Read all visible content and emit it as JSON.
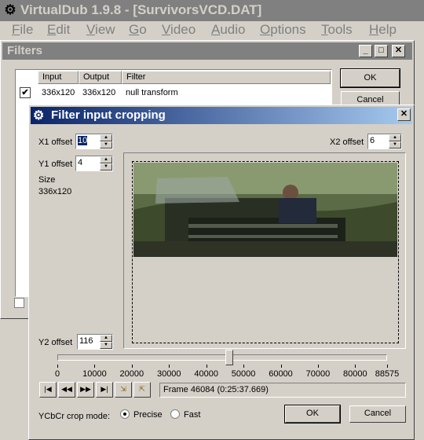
{
  "main": {
    "title": "VirtualDub 1.9.8 - [SurvivorsVCD.DAT]",
    "menu": [
      "File",
      "Edit",
      "View",
      "Go",
      "Video",
      "Audio",
      "Options",
      "Tools",
      "Help"
    ]
  },
  "filters": {
    "title": "Filters",
    "columns": [
      "Input",
      "Output",
      "Filter"
    ],
    "rows": [
      {
        "checked": true,
        "input": "336x120",
        "output": "336x120",
        "filter": "null transform"
      }
    ],
    "ok_label": "OK",
    "cancel_label": "Cancel"
  },
  "crop": {
    "title": "Filter input cropping",
    "x1_label": "X1 offset",
    "x1_value": "10",
    "y1_label": "Y1 offset",
    "y1_value": "4",
    "x2_label": "X2 offset",
    "x2_value": "6",
    "y2_label": "Y2 offset",
    "y2_value": "116",
    "size_label": "Size",
    "size_value": "336x120",
    "ticks": [
      "0",
      "10000",
      "20000",
      "30000",
      "40000",
      "50000",
      "60000",
      "70000",
      "80000",
      "88575"
    ],
    "frame_text": "Frame 46084 (0:25:37.669)",
    "mode_label": "YCbCr crop mode:",
    "precise_label": "Precise",
    "fast_label": "Fast",
    "ok_label": "OK",
    "cancel_label": "Cancel",
    "slider_fraction": 0.5203
  },
  "colors": {
    "title_active": "#0a246a",
    "title_inactive": "#808080",
    "face": "#d4d0c8"
  }
}
